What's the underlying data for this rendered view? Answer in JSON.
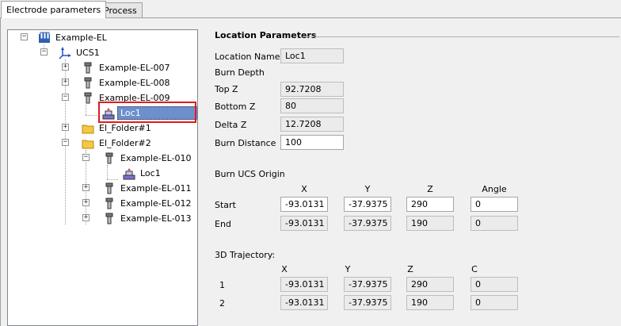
{
  "tabs": [
    {
      "label": "Electrode parameters",
      "active": true
    },
    {
      "label": "Process",
      "active": false
    }
  ],
  "tree": {
    "root": "Example-EL",
    "ucs": "UCS1",
    "el007": "Example-EL-007",
    "el008": "Example-EL-008",
    "el009": "Example-EL-009",
    "loc_selected": "Loc1",
    "folder1": "El_Folder#1",
    "folder2": "El_Folder#2",
    "el010": "Example-EL-010",
    "loc_child": "Loc1",
    "el011": "Example-EL-011",
    "el012": "Example-EL-012",
    "el013": "Example-EL-013"
  },
  "location": {
    "title": "Location Parameters",
    "name_label": "Location Name",
    "name_value": "Loc1",
    "burn_depth_label": "Burn Depth",
    "top_z_label": "Top Z",
    "top_z_value": "92.7208",
    "bottom_z_label": "Bottom Z",
    "bottom_z_value": "80",
    "delta_z_label": "Delta Z",
    "delta_z_value": "12.7208",
    "burn_distance_label": "Burn Distance",
    "burn_distance_value": "100"
  },
  "burn_ucs": {
    "title": "Burn UCS Origin",
    "col_x": "X",
    "col_y": "Y",
    "col_z": "Z",
    "col_angle": "Angle",
    "start_label": "Start",
    "start": {
      "x": "-93.0131",
      "y": "-37.9375",
      "z": "290",
      "angle": "0"
    },
    "end_label": "End",
    "end": {
      "x": "-93.0131",
      "y": "-37.9375",
      "z": "190",
      "angle": "0"
    }
  },
  "trajectory": {
    "title": "3D Trajectory:",
    "col_x": "X",
    "col_y": "Y",
    "col_z": "Z",
    "col_c": "C",
    "row1_label": "1",
    "row1": {
      "x": "-93.0131",
      "y": "-37.9375",
      "z": "290",
      "c": "0"
    },
    "row2_label": "2",
    "row2": {
      "x": "-93.0131",
      "y": "-37.9375",
      "z": "190",
      "c": "0"
    }
  },
  "colors": {
    "selection": "#6d8fcd",
    "highlight_border": "#e21b1b",
    "folder": "#f5c842"
  }
}
